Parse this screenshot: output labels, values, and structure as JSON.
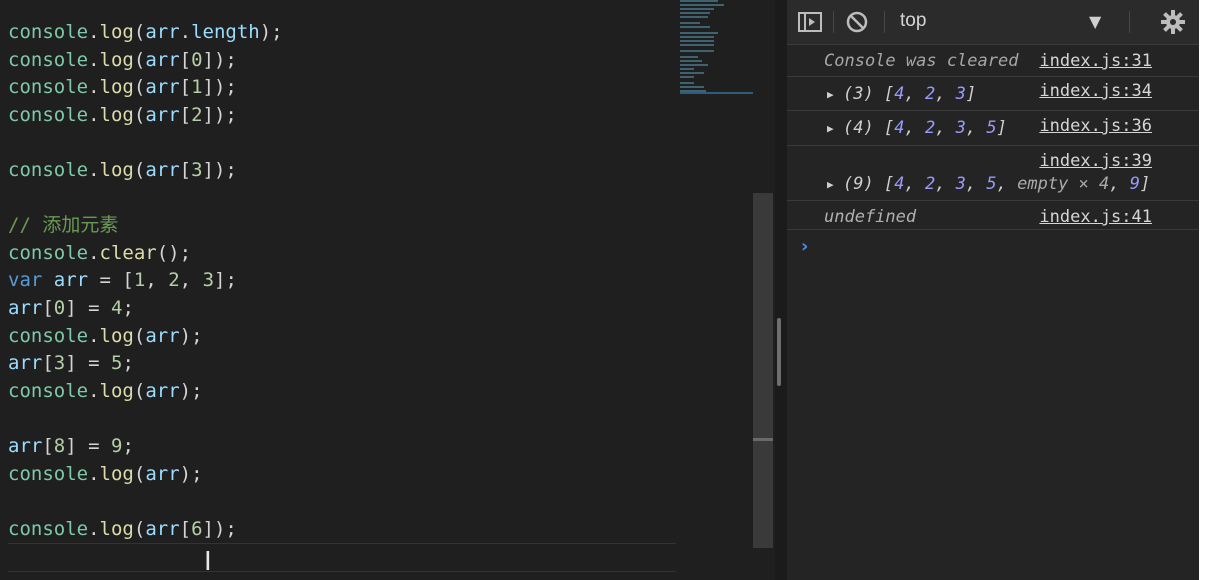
{
  "editor": {
    "lines": [
      [
        [
          "t-ident",
          "console"
        ],
        [
          "t-p",
          "."
        ],
        [
          "t-fn",
          "log"
        ],
        [
          "t-p",
          "("
        ],
        [
          "t-var",
          "arr"
        ],
        [
          "t-p",
          "."
        ],
        [
          "t-var",
          "length"
        ],
        [
          "t-p",
          ");"
        ]
      ],
      [
        [
          "t-ident",
          "console"
        ],
        [
          "t-p",
          "."
        ],
        [
          "t-fn",
          "log"
        ],
        [
          "t-p",
          "("
        ],
        [
          "t-var",
          "arr"
        ],
        [
          "t-p",
          "["
        ],
        [
          "t-num",
          "0"
        ],
        [
          "t-p",
          "]);"
        ]
      ],
      [
        [
          "t-ident",
          "console"
        ],
        [
          "t-p",
          "."
        ],
        [
          "t-fn",
          "log"
        ],
        [
          "t-p",
          "("
        ],
        [
          "t-var",
          "arr"
        ],
        [
          "t-p",
          "["
        ],
        [
          "t-num",
          "1"
        ],
        [
          "t-p",
          "]);"
        ]
      ],
      [
        [
          "t-ident",
          "console"
        ],
        [
          "t-p",
          "."
        ],
        [
          "t-fn",
          "log"
        ],
        [
          "t-p",
          "("
        ],
        [
          "t-var",
          "arr"
        ],
        [
          "t-p",
          "["
        ],
        [
          "t-num",
          "2"
        ],
        [
          "t-p",
          "]);"
        ]
      ],
      [],
      [
        [
          "t-ident",
          "console"
        ],
        [
          "t-p",
          "."
        ],
        [
          "t-fn",
          "log"
        ],
        [
          "t-p",
          "("
        ],
        [
          "t-var",
          "arr"
        ],
        [
          "t-p",
          "["
        ],
        [
          "t-num",
          "3"
        ],
        [
          "t-p",
          "]);"
        ]
      ],
      [],
      [
        [
          "t-cmt",
          "// 添加元素"
        ]
      ],
      [
        [
          "t-ident",
          "console"
        ],
        [
          "t-p",
          "."
        ],
        [
          "t-fn",
          "clear"
        ],
        [
          "t-p",
          "();"
        ]
      ],
      [
        [
          "t-kw",
          "var"
        ],
        [
          "t-p",
          " "
        ],
        [
          "t-var",
          "arr"
        ],
        [
          "t-p",
          " = ["
        ],
        [
          "t-num",
          "1"
        ],
        [
          "t-p",
          ", "
        ],
        [
          "t-num",
          "2"
        ],
        [
          "t-p",
          ", "
        ],
        [
          "t-num",
          "3"
        ],
        [
          "t-p",
          "];"
        ]
      ],
      [
        [
          "t-var",
          "arr"
        ],
        [
          "t-p",
          "["
        ],
        [
          "t-num",
          "0"
        ],
        [
          "t-p",
          "] = "
        ],
        [
          "t-num",
          "4"
        ],
        [
          "t-p",
          ";"
        ]
      ],
      [
        [
          "t-ident",
          "console"
        ],
        [
          "t-p",
          "."
        ],
        [
          "t-fn",
          "log"
        ],
        [
          "t-p",
          "("
        ],
        [
          "t-var",
          "arr"
        ],
        [
          "t-p",
          ");"
        ]
      ],
      [
        [
          "t-var",
          "arr"
        ],
        [
          "t-p",
          "["
        ],
        [
          "t-num",
          "3"
        ],
        [
          "t-p",
          "] = "
        ],
        [
          "t-num",
          "5"
        ],
        [
          "t-p",
          ";"
        ]
      ],
      [
        [
          "t-ident",
          "console"
        ],
        [
          "t-p",
          "."
        ],
        [
          "t-fn",
          "log"
        ],
        [
          "t-p",
          "("
        ],
        [
          "t-var",
          "arr"
        ],
        [
          "t-p",
          ");"
        ]
      ],
      [],
      [
        [
          "t-var",
          "arr"
        ],
        [
          "t-p",
          "["
        ],
        [
          "t-num",
          "8"
        ],
        [
          "t-p",
          "] = "
        ],
        [
          "t-num",
          "9"
        ],
        [
          "t-p",
          ";"
        ]
      ],
      [
        [
          "t-ident",
          "console"
        ],
        [
          "t-p",
          "."
        ],
        [
          "t-fn",
          "log"
        ],
        [
          "t-p",
          "("
        ],
        [
          "t-var",
          "arr"
        ],
        [
          "t-p",
          ");"
        ]
      ],
      [],
      [
        [
          "t-ident",
          "console"
        ],
        [
          "t-p",
          "."
        ],
        [
          "t-fn",
          "log"
        ],
        [
          "t-p",
          "("
        ],
        [
          "t-var",
          "arr"
        ],
        [
          "t-p",
          "["
        ],
        [
          "t-num",
          "6"
        ],
        [
          "t-p",
          "]);"
        ]
      ]
    ]
  },
  "devtools": {
    "context": "top",
    "icons": [
      "sidebar-toggle-icon",
      "clear-console-icon",
      "dropdown-arrow-icon",
      "gear-icon"
    ],
    "messages": {
      "cleared": {
        "text": "Console was cleared",
        "source": "index.js:31"
      },
      "log1": {
        "count": "(3)",
        "items": [
          "4",
          "2",
          "3"
        ],
        "source": "index.js:34"
      },
      "log2": {
        "count": "(4)",
        "items": [
          "4",
          "2",
          "3",
          "5"
        ],
        "source": "index.js:36"
      },
      "log3": {
        "count": "(9)",
        "items": [
          "4",
          "2",
          "3",
          "5"
        ],
        "empty": "empty × 4",
        "last": "9",
        "source": "index.js:39"
      },
      "undefined": {
        "text": "undefined",
        "source": "index.js:41"
      }
    },
    "prompt": "›"
  }
}
